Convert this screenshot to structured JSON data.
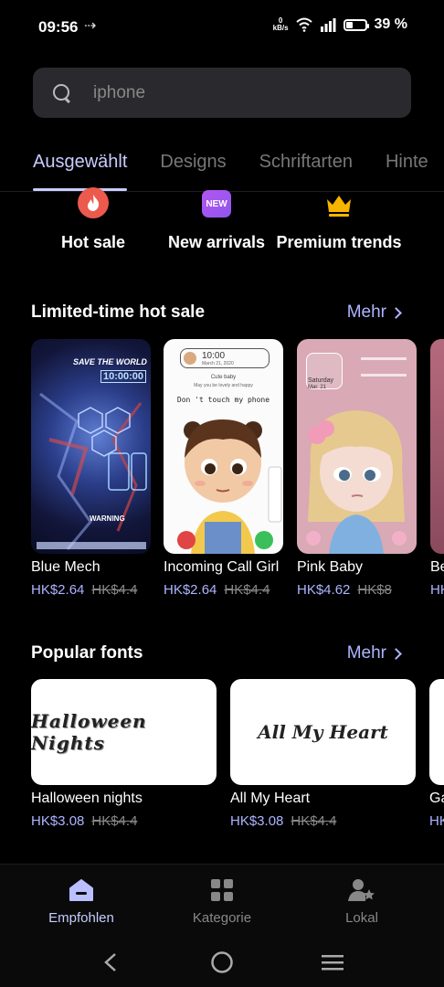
{
  "status": {
    "time": "09:56",
    "speed_value": "0",
    "speed_unit": "kB/s",
    "battery": "39 %",
    "battery_level": 0.39
  },
  "search": {
    "placeholder": "iphone"
  },
  "tabs": [
    {
      "label": "Ausgewählt",
      "active": true
    },
    {
      "label": "Designs"
    },
    {
      "label": "Schriftarten"
    },
    {
      "label": "Hinte"
    }
  ],
  "categories": [
    {
      "label": "Hot sale",
      "icon": "flame-icon"
    },
    {
      "label": "New arrivals",
      "icon": "new-badge-icon",
      "badge": "NEW"
    },
    {
      "label": "Premium trends",
      "icon": "crown-icon"
    }
  ],
  "hot_sale": {
    "title": "Limited-time hot sale",
    "more": "Mehr",
    "items": [
      {
        "name": "Blue Mech",
        "price": "HK$2.64",
        "old_price": "HK$4.4",
        "thumb": {
          "headline": "SAVE THE WORLD",
          "clock": "10:00:00",
          "warning": "WARNING"
        }
      },
      {
        "name": "Incoming Call Girl",
        "price": "HK$2.64",
        "old_price": "HK$4.4",
        "thumb": {
          "time": "10:00",
          "date": "March 21, 2020",
          "caption1": "Cute baby",
          "caption2": "May you be lovely and happy",
          "caption3": "Don 't touch my phone"
        }
      },
      {
        "name": "Pink Baby",
        "price": "HK$4.62",
        "old_price": "HK$8",
        "thumb": {
          "day": "Saturday",
          "date": "Mar. 21"
        }
      },
      {
        "name": "Be",
        "price": "HK",
        "old_price": ""
      }
    ]
  },
  "popular_fonts": {
    "title": "Popular fonts",
    "more": "Mehr",
    "items": [
      {
        "name": "Halloween nights",
        "sample": "Halloween Nights",
        "price": "HK$3.08",
        "old_price": "HK$4.4"
      },
      {
        "name": "All My Heart",
        "sample": "All My Heart",
        "price": "HK$3.08",
        "old_price": "HK$4.4"
      },
      {
        "name": "Ga",
        "price": "HK"
      }
    ]
  },
  "bottom_nav": [
    {
      "label": "Empfohlen",
      "icon": "home-icon",
      "active": true
    },
    {
      "label": "Kategorie",
      "icon": "grid-icon"
    },
    {
      "label": "Lokal",
      "icon": "person-star-icon"
    }
  ],
  "colors": {
    "accent": "#aeb4ff",
    "tab_active": "#c8ccff",
    "background": "#000000"
  }
}
